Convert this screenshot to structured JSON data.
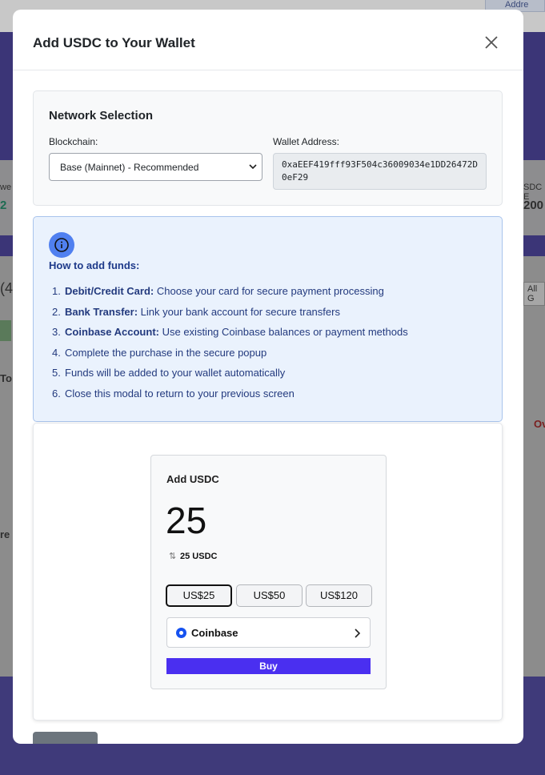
{
  "background": {
    "header_chip": "Addre",
    "stat_left_label": "we",
    "stat_left_value": "2",
    "stat_right_label": "SDC E",
    "stat_right_value": "200",
    "section_left": "(4",
    "filter_right": "All G",
    "row_left": "To",
    "row_right": "Ov",
    "row2_left": "re"
  },
  "modal": {
    "title": "Add USDC to Your Wallet",
    "close_icon": "close-icon"
  },
  "network": {
    "title": "Network Selection",
    "blockchain_label": "Blockchain:",
    "blockchain_value": "Base (Mainnet) - Recommended",
    "wallet_label": "Wallet Address:",
    "wallet_value": "0xaEEF419fff93F504c36009034e1DD26472D0eF29"
  },
  "info": {
    "icon": "info-icon",
    "heading": "How to add funds:",
    "steps": [
      {
        "num": "1.",
        "bold": "Debit/Credit Card:",
        "text": " Choose your card for secure payment processing"
      },
      {
        "num": "2.",
        "bold": "Bank Transfer:",
        "text": " Link your bank account for secure transfers"
      },
      {
        "num": "3.",
        "bold": "Coinbase Account:",
        "text": " Use existing Coinbase balances or payment methods"
      },
      {
        "num": "4.",
        "bold": "",
        "text": "Complete the purchase in the secure popup"
      },
      {
        "num": "5.",
        "bold": "",
        "text": "Funds will be added to your wallet automatically"
      },
      {
        "num": "6.",
        "bold": "",
        "text": "Close this modal to return to your previous screen"
      }
    ]
  },
  "widget": {
    "title": "Add USDC",
    "amount": "25",
    "conversion": "25 USDC",
    "presets": [
      "US$25",
      "US$50",
      "US$120"
    ],
    "selected_preset": "US$25",
    "provider": "Coinbase",
    "buy_label": "Buy"
  },
  "colors": {
    "accent_buy": "#4a2ff0",
    "info_bg": "#eaf2fd",
    "info_text": "#233a7e",
    "coinbase_blue": "#1652f0"
  }
}
